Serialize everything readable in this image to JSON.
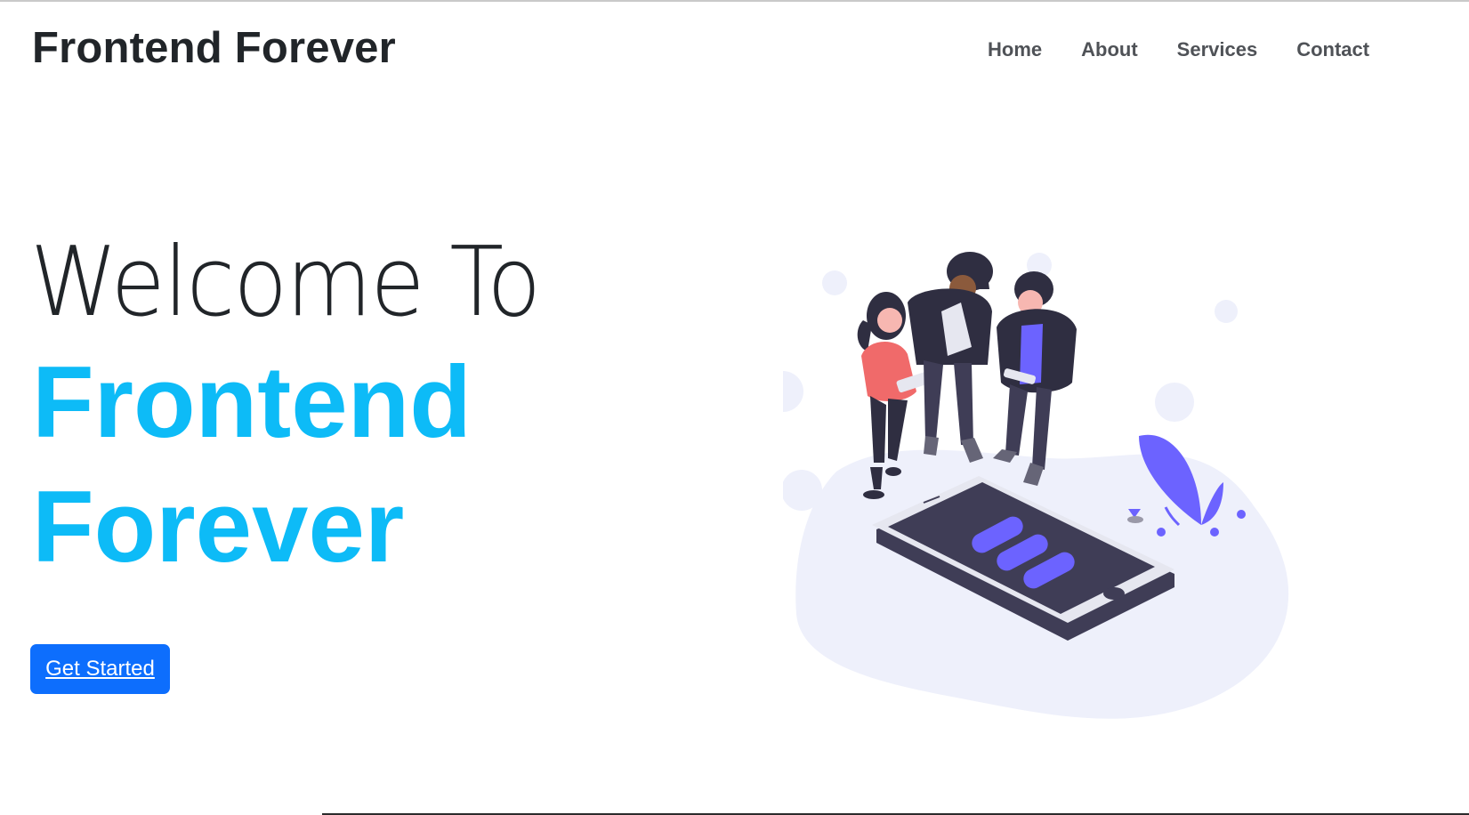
{
  "brand": {
    "title": "Frontend Forever"
  },
  "nav": {
    "items": [
      {
        "label": "Home"
      },
      {
        "label": "About"
      },
      {
        "label": "Services"
      },
      {
        "label": "Contact"
      }
    ]
  },
  "hero": {
    "line1": "Welcome To",
    "line2": "Frontend",
    "line3": "Forever",
    "cta_label": "Get Started"
  },
  "illustration": {
    "icon": "team-phone-illustration",
    "colors": {
      "accent": "#6c63ff",
      "blob": "#eef0fb",
      "dark": "#3f3d56",
      "coral": "#f06a6a",
      "skin": "#f7b7b1"
    }
  },
  "colors": {
    "brand_text": "#212529",
    "hero_accent": "#0dbbf7",
    "button": "#0d6efd",
    "nav_text": "#4f5257"
  }
}
